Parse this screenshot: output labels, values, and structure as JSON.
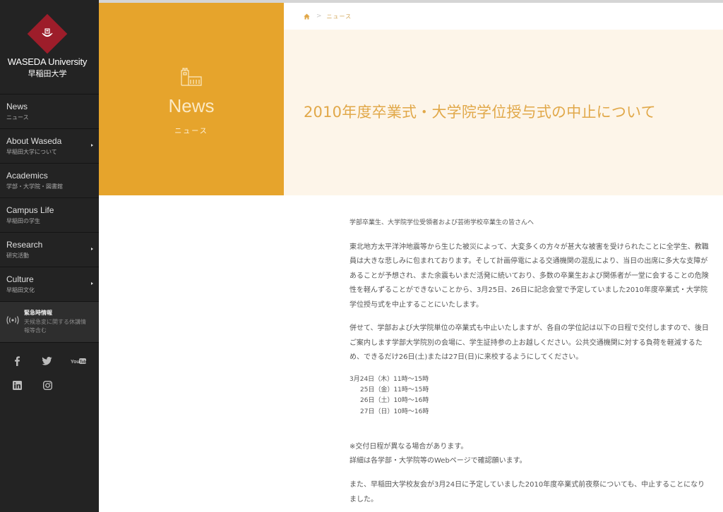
{
  "sidebar": {
    "logo": {
      "name_en": "WASEDA University",
      "name_ja": "早稲田大学",
      "brand_color": "#9d1d2a"
    },
    "nav": [
      {
        "title": "News",
        "subtitle": "ニュース",
        "has_submenu": false
      },
      {
        "title": "About Waseda",
        "subtitle": "早稲田大学について",
        "has_submenu": true
      },
      {
        "title": "Academics",
        "subtitle": "学部・大学院・図書館",
        "has_submenu": false
      },
      {
        "title": "Campus Life",
        "subtitle": "早稲田の学生",
        "has_submenu": false
      },
      {
        "title": "Research",
        "subtitle": "研究活動",
        "has_submenu": true
      },
      {
        "title": "Culture",
        "subtitle": "早稲田文化",
        "has_submenu": true
      }
    ],
    "emergency": {
      "icon": "broadcast-icon",
      "title": "緊急時情報",
      "subtitle": "天候急変に関する休講情報等含む"
    },
    "social": [
      {
        "name": "facebook",
        "icon": "facebook-icon"
      },
      {
        "name": "twitter",
        "icon": "twitter-icon"
      },
      {
        "name": "youtube",
        "icon": "youtube-icon"
      },
      {
        "name": "linkedin",
        "icon": "linkedin-icon"
      },
      {
        "name": "instagram",
        "icon": "instagram-icon"
      }
    ]
  },
  "hero": {
    "icon": "building-icon",
    "title": "News",
    "subtitle": "ニュース",
    "accent_color": "#e6a42c"
  },
  "breadcrumb": {
    "home_icon": "home-icon",
    "separator": ">",
    "current": "ニュース"
  },
  "article": {
    "title": "2010年度卒業式・大学院学位授与式の中止について",
    "greeting": "学部卒業生、大学院学位受領者および芸術学校卒業生の皆さんへ",
    "paragraph1": "東北地方太平洋沖地震等から生じた被災によって、大変多くの方々が甚大な被害を受けられたことに全学生、教職員は大きな悲しみに包まれております。そして計画停電による交通機関の混乱により、当日の出席に多大な支障があることが予想され、また余震もいまだ活発に続いており、多数の卒業生および関係者が一堂に会することの危険性を軽んずることができないことから、3月25日、26日に記念会堂で予定していました2010年度卒業式・大学院学位授与式を中止することにいたします。",
    "paragraph2": "併せて、学部および大学院単位の卒業式も中止いたしますが、各自の学位記は以下の日程で交付しますので、後日ご案内します学部大学院別の会場に、学生証持参の上お越しください。公共交通機関に対する負荷を軽減するため、できるだけ26日(土)または27日(日)に来校するようにしてください。",
    "schedule": [
      "3月24日（木）11時～15時",
      "25日（金）11時～15時",
      "26日（土）10時～16時",
      "27日（日）10時～16時"
    ],
    "note1": "※交付日程が異なる場合があります。",
    "note2": "詳細は各学部・大学院等のWebページで確認願います。",
    "paragraph3": "また、早稲田大学校友会が3月24日に予定していました2010年度卒業式前夜祭についても、中止することになりました。"
  }
}
